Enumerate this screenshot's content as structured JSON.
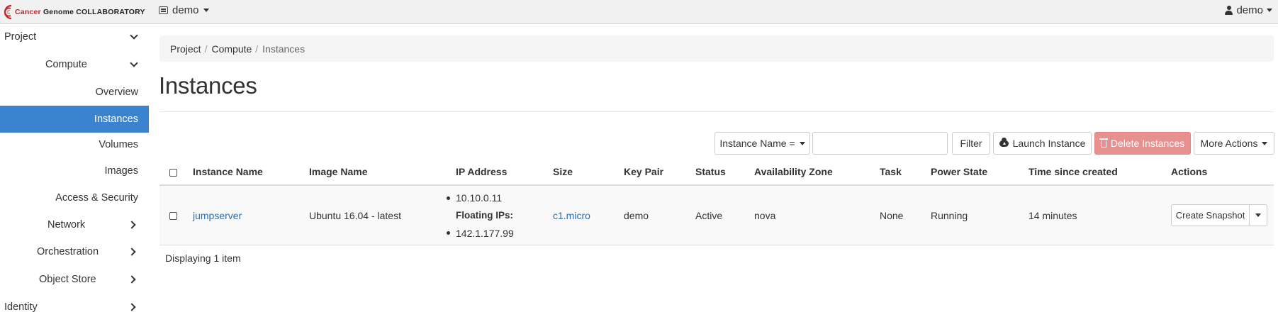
{
  "header": {
    "brand_prefix": "Cancer",
    "brand_suffix": "Genome COLLABORATORY",
    "project_selector": "demo",
    "user": "demo"
  },
  "sidebar": {
    "project": "Project",
    "compute": "Compute",
    "overview": "Overview",
    "instances": "Instances",
    "volumes": "Volumes",
    "images": "Images",
    "access_security": "Access & Security",
    "network": "Network",
    "orchestration": "Orchestration",
    "object_store": "Object Store",
    "identity": "Identity"
  },
  "breadcrumb": {
    "project": "Project",
    "compute": "Compute",
    "current": "Instances",
    "sep": "/"
  },
  "page": {
    "title": "Instances"
  },
  "toolbar": {
    "filter_field": "Instance Name =",
    "search_value": "",
    "filter_label": "Filter",
    "launch_label": "Launch Instance",
    "delete_label": "Delete Instances",
    "more_label": "More Actions"
  },
  "table": {
    "columns": {
      "name": "Instance Name",
      "image": "Image Name",
      "ip": "IP Address",
      "size": "Size",
      "keypair": "Key Pair",
      "status": "Status",
      "zone": "Availability Zone",
      "task": "Task",
      "power": "Power State",
      "age": "Time since created",
      "actions": "Actions"
    },
    "rows": [
      {
        "name": "jumpserver",
        "image": "Ubuntu 16.04 - latest",
        "ip_fixed": "10.10.0.11",
        "floating_label": "Floating IPs:",
        "ip_floating": "142.1.177.99",
        "size": "c1.micro",
        "keypair": "demo",
        "status": "Active",
        "zone": "nova",
        "task": "None",
        "power": "Running",
        "age": "14 minutes",
        "action": "Create Snapshot"
      }
    ],
    "footer": "Displaying 1 item"
  },
  "colors": {
    "active_nav": "#3a83cf",
    "link": "#2d6ca8",
    "danger": "#e8908f",
    "brand_red": "#c4262e"
  }
}
